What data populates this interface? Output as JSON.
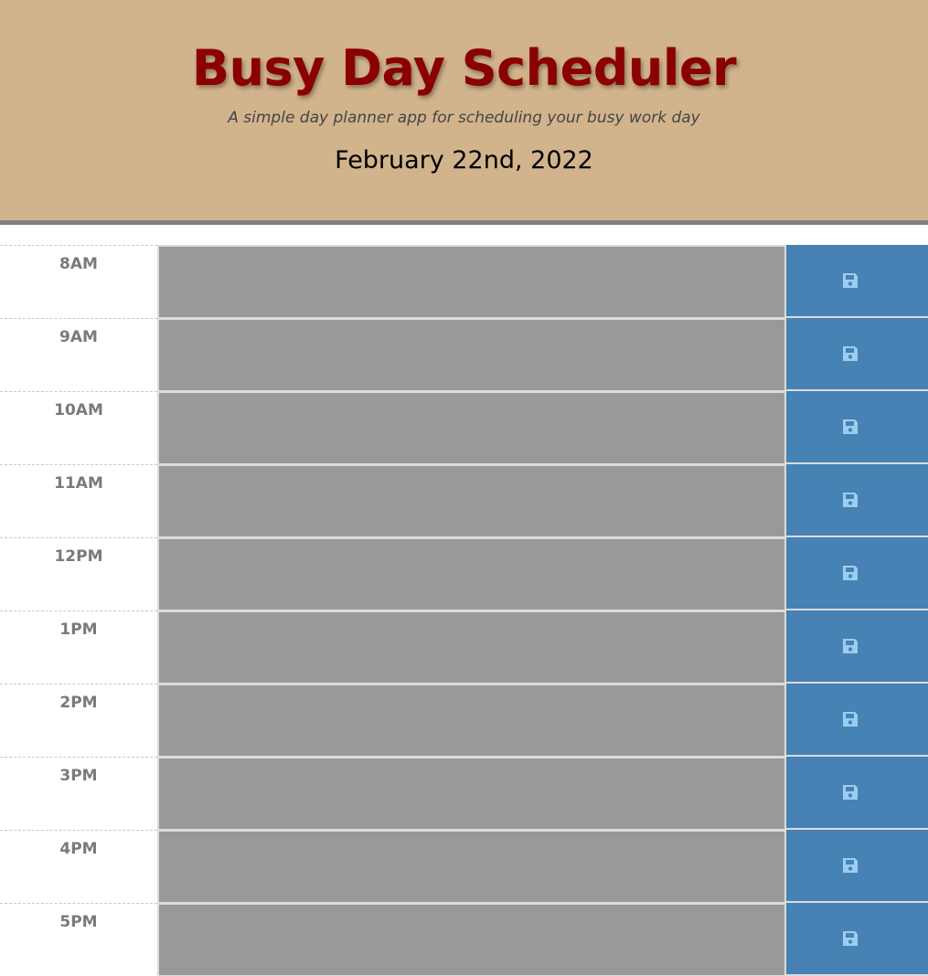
{
  "header": {
    "title": "Busy Day Scheduler",
    "subtitle": "A simple day planner app for scheduling your busy work day",
    "current_date": "February 22nd, 2022"
  },
  "colors": {
    "header_background": "#d2b48c",
    "title": "#8b0000",
    "past_block": "#999999",
    "save_button": "#4682b4",
    "save_icon": "#9ccdf0"
  },
  "time_blocks": [
    {
      "hour": "8AM",
      "text": "",
      "state": "past"
    },
    {
      "hour": "9AM",
      "text": "",
      "state": "past"
    },
    {
      "hour": "10AM",
      "text": "",
      "state": "past"
    },
    {
      "hour": "11AM",
      "text": "",
      "state": "past"
    },
    {
      "hour": "12PM",
      "text": "",
      "state": "past"
    },
    {
      "hour": "1PM",
      "text": "",
      "state": "past"
    },
    {
      "hour": "2PM",
      "text": "",
      "state": "past"
    },
    {
      "hour": "3PM",
      "text": "",
      "state": "past"
    },
    {
      "hour": "4PM",
      "text": "",
      "state": "past"
    },
    {
      "hour": "5PM",
      "text": "",
      "state": "past"
    }
  ],
  "save_icon_name": "floppy-disk-icon"
}
